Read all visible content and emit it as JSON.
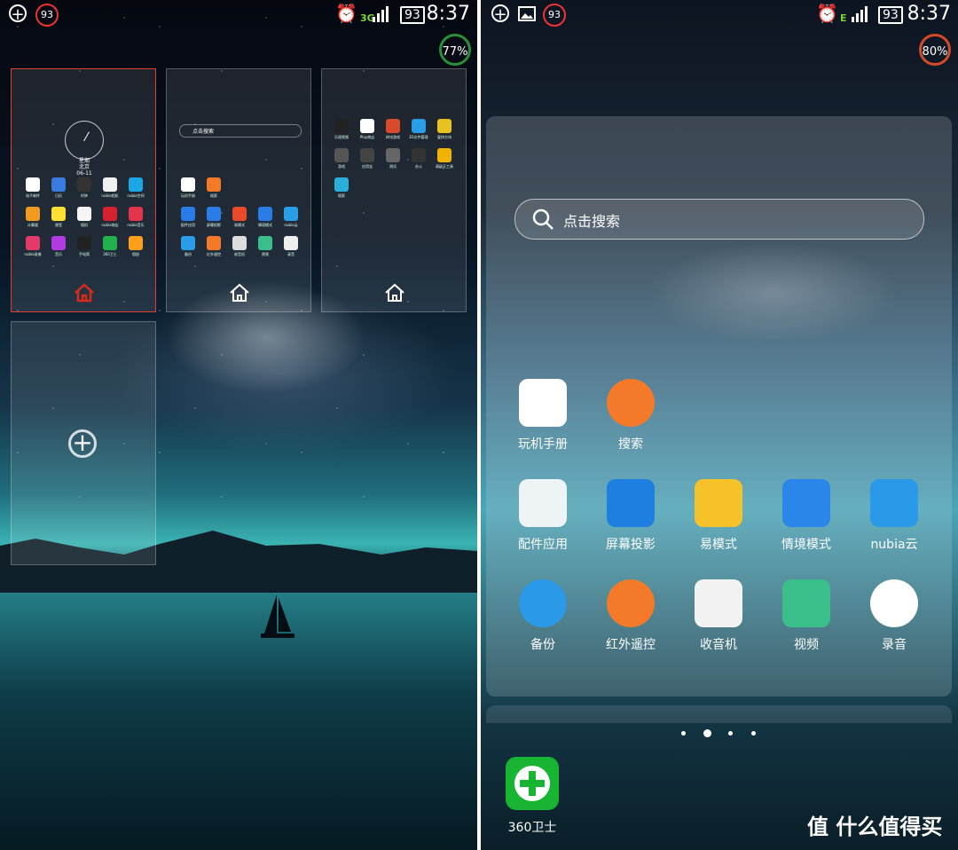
{
  "left_screen": {
    "status": {
      "badge": "93",
      "net": "3G",
      "battery": "93",
      "time": "8:37"
    },
    "memory_pct": "77%",
    "preview1": {
      "clock_weekday": "星期",
      "clock_city": "北京",
      "clock_date": "06-11",
      "apps": [
        "电子邮件",
        "日历",
        "时钟",
        "nubia相机",
        "nubia空间",
        "计算器",
        "便签",
        "相机",
        "nubia商店",
        "nubia音乐",
        "nubia录像",
        "音乐",
        "手电筒",
        "360卫士",
        "相册"
      ]
    },
    "preview2": {
      "search": "点击搜索",
      "apps": [
        "玩机手册",
        "搜索",
        "配件应用",
        "屏幕投影",
        "易模式",
        "情境模式",
        "nubia云",
        "备份",
        "红外遥控",
        "收音机",
        "视频",
        "录音"
      ]
    },
    "preview3": {
      "apps": [
        "乐视视频",
        "Play商店",
        "砖块游戏",
        "ES文件管理",
        "爱拼方块",
        "游戏",
        "应用宝",
        "测试",
        "办公",
        "高级天工具",
        "搜索"
      ]
    }
  },
  "right_screen": {
    "status": {
      "badge": "93",
      "net": "E",
      "battery": "93",
      "time": "8:37"
    },
    "memory_pct": "80%",
    "search_placeholder": "点击搜索",
    "apps": [
      {
        "label": "玩机手册",
        "icon": "manual-icon"
      },
      {
        "label": "搜索",
        "icon": "search-app-icon"
      },
      {
        "label": "配件应用",
        "icon": "accessory-apps-icon"
      },
      {
        "label": "屏幕投影",
        "icon": "screen-projection-icon"
      },
      {
        "label": "易模式",
        "icon": "easy-mode-icon"
      },
      {
        "label": "情境模式",
        "icon": "scene-mode-icon"
      },
      {
        "label": "nubia云",
        "icon": "cloud-icon"
      },
      {
        "label": "备份",
        "icon": "backup-icon"
      },
      {
        "label": "红外遥控",
        "icon": "ir-remote-icon"
      },
      {
        "label": "收音机",
        "icon": "radio-icon"
      },
      {
        "label": "视频",
        "icon": "video-icon"
      },
      {
        "label": "录音",
        "icon": "recorder-icon"
      }
    ],
    "dock_app": "360卫士",
    "watermark": "值 什么值得买"
  },
  "colors": {
    "accent_red": "#e0402f",
    "orange": "#f47a2a",
    "green": "#1fbf3a",
    "blue": "#2a7de8"
  }
}
